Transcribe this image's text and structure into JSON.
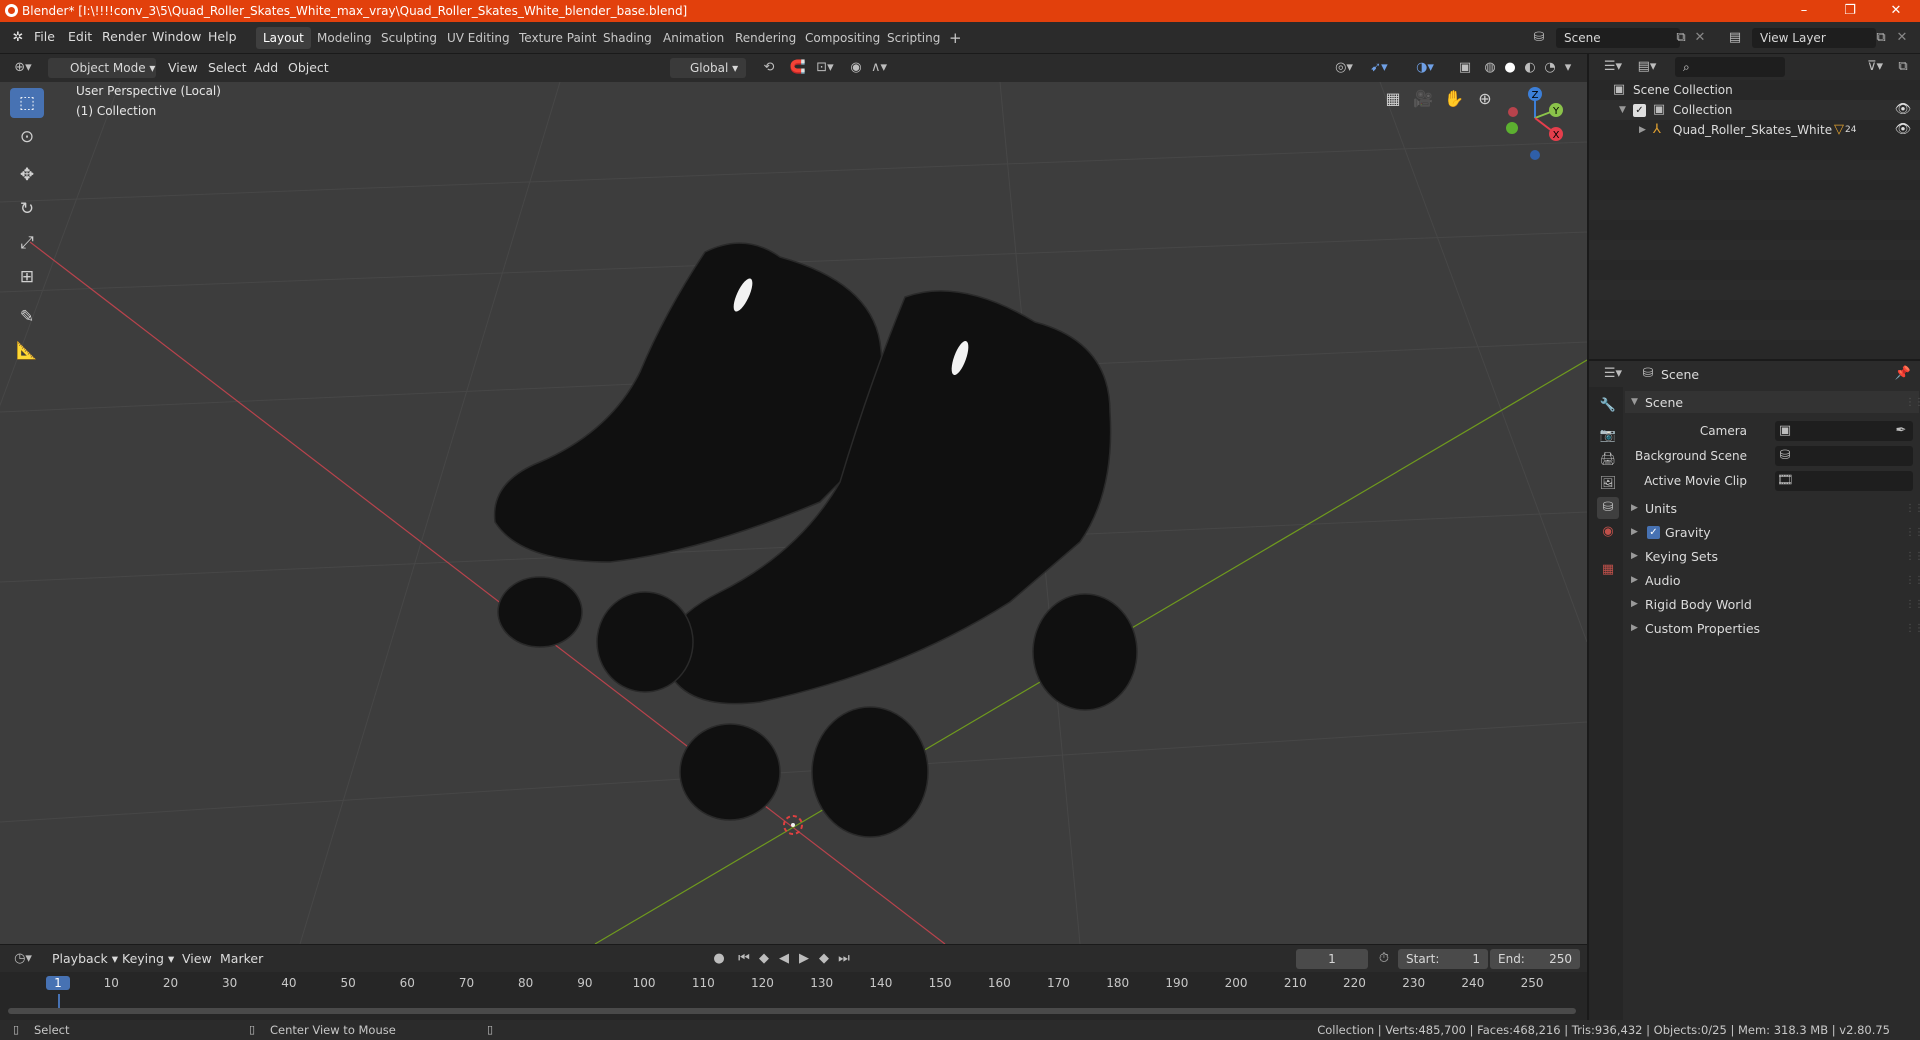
{
  "window": {
    "title": "Blender* [I:\\!!!!conv_3\\5\\Quad_Roller_Skates_White_max_vray\\Quad_Roller_Skates_White_blender_base.blend]",
    "controls": [
      "–",
      "❐",
      "✕"
    ]
  },
  "menubar": {
    "items": [
      "File",
      "Edit",
      "Render",
      "Window",
      "Help"
    ],
    "workspaces": [
      "Layout",
      "Modeling",
      "Sculpting",
      "UV Editing",
      "Texture Paint",
      "Shading",
      "Animation",
      "Rendering",
      "Compositing",
      "Scripting",
      "+"
    ],
    "active_workspace": "Layout",
    "scene": "Scene",
    "view_layer": "View Layer"
  },
  "viewport_header": {
    "mode": "Object Mode",
    "menus": [
      "View",
      "Select",
      "Add",
      "Object"
    ],
    "transform_orientation": "Global"
  },
  "viewport": {
    "view_name": "User Perspective (Local)",
    "collection_label": "(1) Collection",
    "gizmo_axes": [
      "Z",
      "Y",
      "X"
    ],
    "colors": {
      "background": "#3d3d3d",
      "x_axis": "#b8434c",
      "y_axis": "#6f9a1e"
    }
  },
  "tools": [
    "select-box",
    "cursor",
    "move",
    "rotate",
    "scale",
    "transform",
    "annotate",
    "measure"
  ],
  "timeline": {
    "menus": [
      "Playback",
      "Keying",
      "View",
      "Marker"
    ],
    "current_frame": "1",
    "start_label": "Start:",
    "start": "1",
    "end_label": "End:",
    "end": "250",
    "ticks": [
      "1",
      "10",
      "20",
      "30",
      "40",
      "50",
      "60",
      "70",
      "80",
      "90",
      "100",
      "110",
      "120",
      "130",
      "140",
      "150",
      "160",
      "170",
      "180",
      "190",
      "200",
      "210",
      "220",
      "230",
      "240",
      "250"
    ]
  },
  "outliner": {
    "root": "Scene Collection",
    "collection": "Collection",
    "object": "Quad_Roller_Skates_White",
    "object_badge": "24"
  },
  "properties": {
    "context": "Scene",
    "panel_title": "Scene",
    "fields": [
      {
        "label": "Camera"
      },
      {
        "label": "Background Scene"
      },
      {
        "label": "Active Movie Clip"
      }
    ],
    "sections": [
      "Units",
      "Gravity",
      "Keying Sets",
      "Audio",
      "Rigid Body World",
      "Custom Properties"
    ],
    "gravity_checked": true
  },
  "statusbar": {
    "left_action": "Select",
    "mid_action": "Center View to Mouse",
    "stats": "Collection | Verts:485,700 | Faces:468,216 | Tris:936,432 | Objects:0/25 | Mem: 318.3 MB | v2.80.75"
  }
}
